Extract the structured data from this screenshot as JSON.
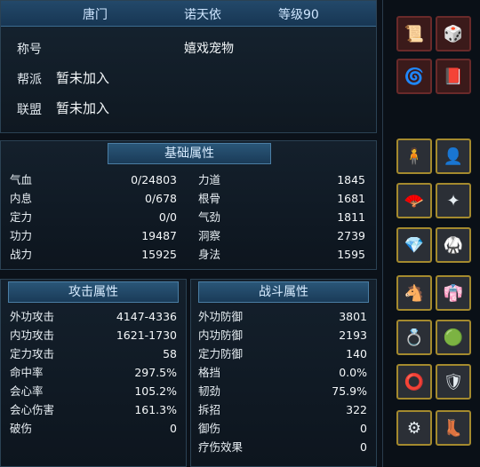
{
  "header": {
    "sect": "唐门",
    "name": "诺天依",
    "level": "等级90"
  },
  "profile": {
    "title_label": "称号",
    "title_value": "嬉戏宠物",
    "guild_label": "帮派",
    "guild_value": "暂未加入",
    "alliance_label": "联盟",
    "alliance_value": "暂未加入"
  },
  "base": {
    "title": "基础属性",
    "left": [
      {
        "k": "气血",
        "v": "0/24803"
      },
      {
        "k": "内息",
        "v": "0/678"
      },
      {
        "k": "定力",
        "v": "0/0"
      },
      {
        "k": "功力",
        "v": "19487"
      },
      {
        "k": "战力",
        "v": "15925"
      }
    ],
    "right": [
      {
        "k": "力道",
        "v": "1845"
      },
      {
        "k": "根骨",
        "v": "1681"
      },
      {
        "k": "气劲",
        "v": "1811"
      },
      {
        "k": "洞察",
        "v": "2739"
      },
      {
        "k": "身法",
        "v": "1595"
      }
    ]
  },
  "attack": {
    "title": "攻击属性",
    "rows": [
      {
        "k": "外功攻击",
        "v": "4147-4336"
      },
      {
        "k": "内功攻击",
        "v": "1621-1730"
      },
      {
        "k": "定力攻击",
        "v": "58"
      },
      {
        "k": "命中率",
        "v": "297.5%"
      },
      {
        "k": "会心率",
        "v": "105.2%"
      },
      {
        "k": "会心伤害",
        "v": "161.3%"
      },
      {
        "k": "破伤",
        "v": "0"
      }
    ]
  },
  "combat": {
    "title": "战斗属性",
    "rows": [
      {
        "k": "外功防御",
        "v": "3801"
      },
      {
        "k": "内功防御",
        "v": "2193"
      },
      {
        "k": "定力防御",
        "v": "140"
      },
      {
        "k": "格挡",
        "v": "0.0%"
      },
      {
        "k": "韧劲",
        "v": "75.9%"
      },
      {
        "k": "拆招",
        "v": "322"
      },
      {
        "k": "御伤",
        "v": "0"
      },
      {
        "k": "疗伤效果",
        "v": "0"
      }
    ]
  },
  "equipment": {
    "top": [
      "book-icon",
      "dice-box-icon",
      "scroll-icon",
      "tome-icon"
    ],
    "grid": [
      "figure-icon",
      "hair-icon",
      "fan-icon",
      "pendant-icon",
      "gem-icon",
      "armor-icon",
      "horse-icon",
      "robe-icon",
      "ring-icon",
      "jade-icon",
      "bracelet-icon",
      "shoulder-icon",
      "belt-icon",
      "boots-icon"
    ]
  },
  "colors": {
    "header_bg": "#1c4262",
    "frame_border": "#a48a2e",
    "panel_bg": "#101a24"
  }
}
